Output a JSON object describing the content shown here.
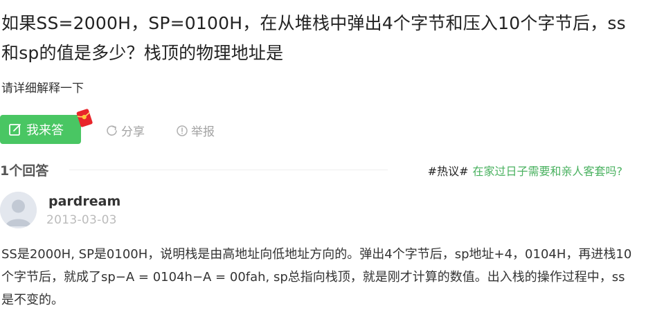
{
  "question": {
    "title": "如果SS=2000H，SP=0100H，在从堆栈中弹出4个字节和压入10个字节后，ss和sp的值是多少？栈顶的物理地址是",
    "description": "请详细解释一下"
  },
  "actions": {
    "answer_label": "我来答",
    "share_label": "分享",
    "report_label": "举报"
  },
  "answers_header": {
    "count_label": "1个回答",
    "hot_tag": "#热议#",
    "hot_link": "在家过日子需要和亲人客套吗?"
  },
  "answer": {
    "username": "pardream",
    "date": "2013-03-03",
    "body": "SS是2000H, SP是0100H，说明栈是由高地址向低地址方向的。弹出4个字节后，sp地址+4，0104H，再进栈10个字节后，就成了sp−A = 0104h−A = 00fah, sp总指向栈顶，就是刚才计算的数值。出入栈的操作过程中，ss是不变的。"
  },
  "colors": {
    "accent_green": "#49c663",
    "link_green": "#49b15f",
    "muted_gray": "#a3a3a3",
    "redpacket_red": "#e8262b"
  },
  "icons": {
    "answer": "edit-icon",
    "redpacket": "red-envelope-icon",
    "share": "share-icon",
    "report": "report-icon",
    "avatar": "default-avatar-icon"
  }
}
